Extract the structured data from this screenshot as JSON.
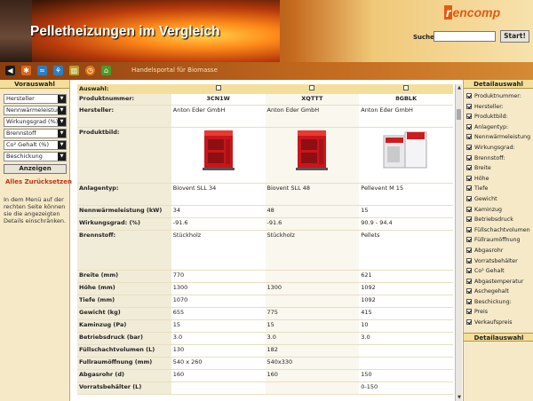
{
  "header": {
    "title": "Pelletheizungen im Vergleich",
    "logo_a": "r",
    "logo_b": "encomp",
    "search_label": "Suche:",
    "search_value": "",
    "search_button": "Start!"
  },
  "toolbar": {
    "text": "Handelsportal für Biomasse",
    "icons": [
      "back-icon",
      "gear-icon",
      "wave-icon",
      "fan-icon",
      "pellet-icon",
      "timer-icon",
      "home-icon"
    ]
  },
  "left": {
    "title": "Vorauswahl",
    "selects": [
      "Hersteller",
      "Nennwärmeleistung (k",
      "Wirkungsgrad (%)",
      "Brennstoff",
      "Co² Gehalt (%)",
      "Beschickung"
    ],
    "show_button": "Anzeigen",
    "reset": "Alles Zurücksetzen",
    "help": "In dem Menü auf der rechten Seite können sie die angezeigten Details einschränken."
  },
  "table": {
    "select_label": "Auswahl:",
    "rows": [
      {
        "label": "Produktnummer:",
        "v": [
          "3CN1W",
          "XQTTT",
          "8GBLK"
        ]
      },
      {
        "label": "Hersteller:",
        "v": [
          "Anton Eder GmbH",
          "Anton Eder GmbH",
          "Anton Eder GmbH"
        ]
      },
      {
        "label": "Produktbild:",
        "v": [
          "",
          "",
          ""
        ]
      },
      {
        "label": "Anlagentyp:",
        "v": [
          "Biovent SLL 34",
          "Biovent SLL 48",
          "Pellevent M 15"
        ]
      },
      {
        "label": "Nennwärmeleistung (kW)",
        "v": [
          "34",
          "48",
          "15"
        ]
      },
      {
        "label": "Wirkungsgrad: (%)",
        "v": [
          "-91.6",
          "-91.6",
          "90.9 - 94.4"
        ]
      },
      {
        "label": "Brennstoff:",
        "v": [
          "Stückholz",
          "Stückholz",
          "Pellets"
        ]
      },
      {
        "label": "Breite (mm)",
        "v": [
          "770",
          "",
          "621"
        ]
      },
      {
        "label": "Höhe (mm)",
        "v": [
          "1300",
          "1300",
          "1092"
        ]
      },
      {
        "label": "Tiefe (mm)",
        "v": [
          "1070",
          "",
          "1092"
        ]
      },
      {
        "label": "Gewicht (kg)",
        "v": [
          "655",
          "775",
          "415"
        ]
      },
      {
        "label": "Kaminzug (Pa)",
        "v": [
          "15",
          "15",
          "10"
        ]
      },
      {
        "label": "Betriebsdruck (bar)",
        "v": [
          "3.0",
          "3.0",
          "3.0"
        ]
      },
      {
        "label": "Füllschachtvolumen (L)",
        "v": [
          "130",
          "182",
          ""
        ]
      },
      {
        "label": "Fullraumöffnung (mm)",
        "v": [
          "540 x 260",
          "540x330",
          ""
        ]
      },
      {
        "label": "Abgasrohr (d)",
        "v": [
          "160",
          "160",
          "150"
        ]
      },
      {
        "label": "Vorratsbehälter (L)",
        "v": [
          "",
          "",
          "0-150"
        ]
      }
    ]
  },
  "right": {
    "title": "Detailauswahl",
    "items": [
      "Produktnummer:",
      "Hersteller:",
      "Produktbild:",
      "Anlagentyp:",
      "Nennwärmeleistung",
      "Wirkungsgrad:",
      "Brennstoff:",
      "Breite",
      "Höhe",
      "Tiefe",
      "Gewicht",
      "Kaminzug",
      "Betriebsdruck",
      "Füllschachtvolumen",
      "Füllraumöffnung",
      "Abgasrohr",
      "Vorratsbehälter",
      "Co² Gehalt",
      "Abgastemperatur",
      "Aschegehalt",
      "Beschickung:",
      "Preis",
      "Verkaufspreis"
    ],
    "bottom_title": "Detailauswahl"
  }
}
